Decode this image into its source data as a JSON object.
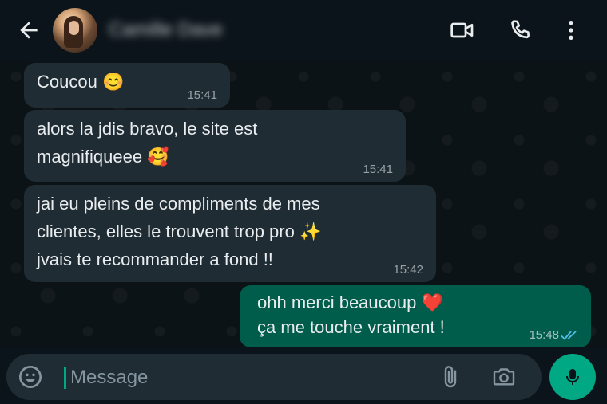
{
  "header": {
    "contact_name": "Camille Dave",
    "back_icon": "arrow-left-icon",
    "video_icon": "video-call-icon",
    "phone_icon": "phone-call-icon",
    "menu_icon": "more-vert-icon"
  },
  "messages": [
    {
      "direction": "in",
      "lines": [
        "Coucou 😊"
      ],
      "time": "15:41"
    },
    {
      "direction": "in",
      "lines": [
        "alors la jdis bravo, le site est",
        "magnifiqueee 🥰"
      ],
      "time": "15:41"
    },
    {
      "direction": "in",
      "lines": [
        "jai eu pleins de compliments de mes",
        "clientes, elles le trouvent trop pro ✨",
        "jvais te recommander a fond !!"
      ],
      "time": "15:42"
    },
    {
      "direction": "out",
      "lines": [
        "ohh merci beaucoup ❤️",
        "ça me touche vraiment !"
      ],
      "time": "15:48",
      "status": "read"
    }
  ],
  "composer": {
    "placeholder": "Message",
    "value": ""
  },
  "colors": {
    "background": "#0b141a",
    "incoming_bubble": "#1f2c34",
    "outgoing_bubble": "#005c4b",
    "accent": "#00a884",
    "read_ticks": "#53bdeb"
  }
}
